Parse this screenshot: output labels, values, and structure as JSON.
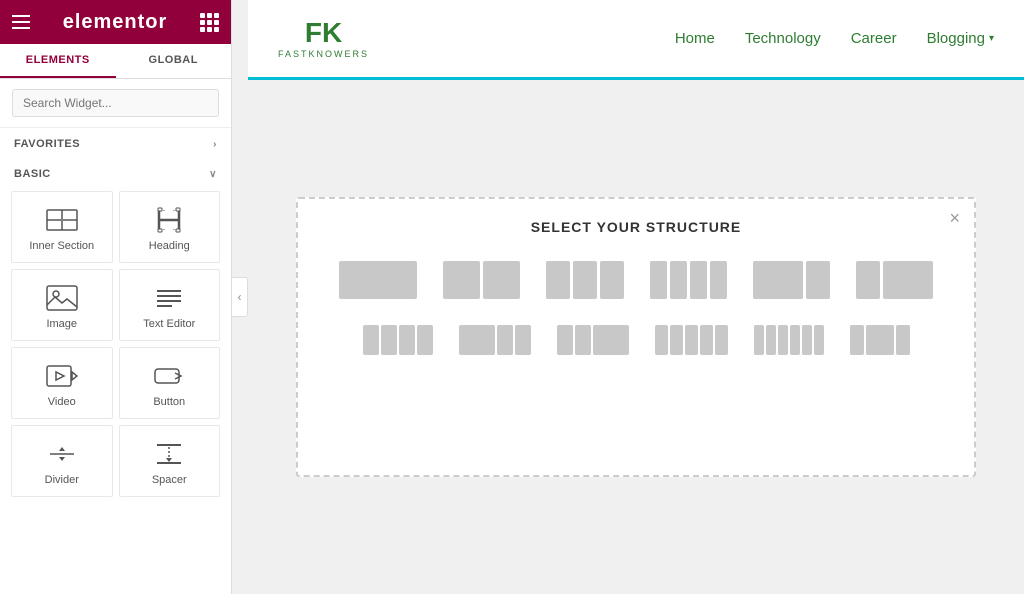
{
  "sidebar": {
    "logo": "elementor",
    "tabs": [
      {
        "label": "ELEMENTS",
        "active": true
      },
      {
        "label": "GLOBAL",
        "active": false
      }
    ],
    "search_placeholder": "Search Widget...",
    "favorites_label": "FAVORITES",
    "basic_label": "BASIC",
    "widgets": [
      {
        "id": "inner-section",
        "label": "Inner Section",
        "icon": "inner-section-icon"
      },
      {
        "id": "heading",
        "label": "Heading",
        "icon": "heading-icon"
      },
      {
        "id": "image",
        "label": "Image",
        "icon": "image-icon"
      },
      {
        "id": "text-editor",
        "label": "Text Editor",
        "icon": "text-editor-icon"
      },
      {
        "id": "video",
        "label": "Video",
        "icon": "video-icon"
      },
      {
        "id": "button",
        "label": "Button",
        "icon": "button-icon"
      },
      {
        "id": "divider",
        "label": "Divider",
        "icon": "divider-icon"
      },
      {
        "id": "spacer",
        "label": "Spacer",
        "icon": "spacer-icon"
      }
    ]
  },
  "topnav": {
    "logo_text": "FK",
    "logo_sub": "FASTKNOWERS",
    "nav_links": [
      {
        "label": "Home",
        "dropdown": false
      },
      {
        "label": "Technology",
        "dropdown": false
      },
      {
        "label": "Career",
        "dropdown": false
      },
      {
        "label": "Blogging",
        "dropdown": true
      }
    ]
  },
  "structure_popup": {
    "title": "SELECT YOUR STRUCTURE",
    "close_label": "×",
    "rows": [
      {
        "options": [
          {
            "cols": 1,
            "label": "1 column"
          },
          {
            "cols": 2,
            "label": "2 columns"
          },
          {
            "cols": 3,
            "label": "3 columns"
          },
          {
            "cols": 4,
            "label": "4 columns"
          },
          {
            "cols": "2-1",
            "label": "2/3 + 1/3"
          },
          {
            "cols": "1-2",
            "label": "1/3 + 2/3"
          }
        ]
      },
      {
        "options": [
          {
            "cols": "1-1-1-1",
            "label": "4 equal cols"
          },
          {
            "cols": "2-1-1",
            "label": "wide + 2"
          },
          {
            "cols": "1-2-1",
            "label": "side + wide + side"
          },
          {
            "cols": "1-1-2",
            "label": "2 + wide"
          },
          {
            "cols": "equal5",
            "label": "5 equal"
          },
          {
            "cols": "equal6",
            "label": "6 equal"
          }
        ]
      }
    ]
  },
  "colors": {
    "brand": "#92003b",
    "green": "#2e7d32",
    "accent": "#00bcd4"
  }
}
